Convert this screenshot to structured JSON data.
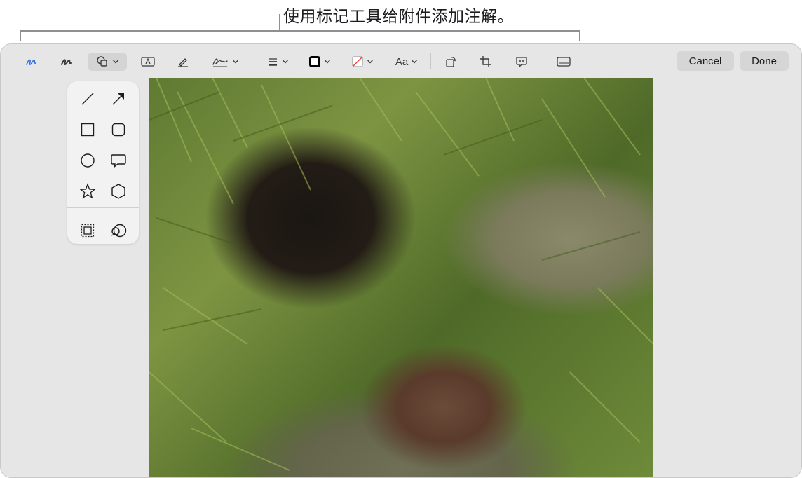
{
  "callout": {
    "text": "使用标记工具给附件添加注解。"
  },
  "toolbar": {
    "tools": [
      {
        "name": "sketch",
        "icon": "sketch-icon"
      },
      {
        "name": "draw",
        "icon": "draw-icon"
      },
      {
        "name": "shapes",
        "icon": "shapes-icon",
        "active": true
      },
      {
        "name": "text",
        "icon": "text-box-icon"
      },
      {
        "name": "highlight",
        "icon": "highlight-icon"
      },
      {
        "name": "sign",
        "icon": "signature-icon"
      },
      {
        "name": "shape-style",
        "icon": "line-style-icon"
      },
      {
        "name": "border-color",
        "icon": "border-color-icon"
      },
      {
        "name": "fill-color",
        "icon": "fill-color-icon"
      },
      {
        "name": "text-style",
        "icon": "text-style-icon",
        "label": "Aa"
      },
      {
        "name": "rotate",
        "icon": "rotate-icon"
      },
      {
        "name": "crop",
        "icon": "crop-icon"
      },
      {
        "name": "description",
        "icon": "description-icon"
      },
      {
        "name": "annotate-page",
        "icon": "page-icon"
      }
    ],
    "cancel_label": "Cancel",
    "done_label": "Done"
  },
  "shapes_menu": {
    "items": [
      "line",
      "arrow",
      "rectangle",
      "rounded-rectangle",
      "oval",
      "speech-bubble",
      "star",
      "polygon",
      "mask",
      "loupe"
    ]
  },
  "colors": {
    "accent": "#2f6fe0",
    "window_bg": "#e6e6e6",
    "button_bg": "#d6d6d6"
  }
}
